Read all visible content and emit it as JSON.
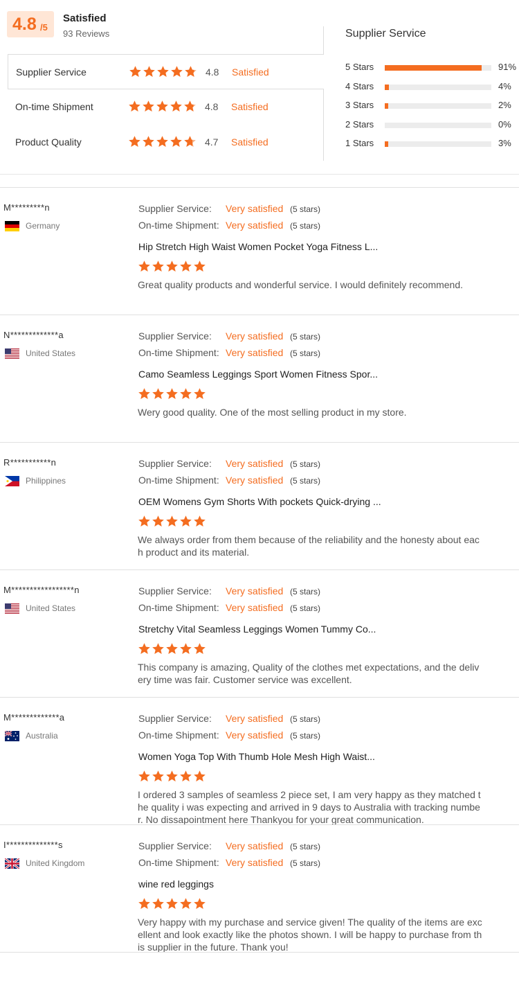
{
  "summary": {
    "score": "4.8",
    "score_suffix": "/5",
    "label": "Satisfied",
    "reviews_count": "93 Reviews"
  },
  "ratings": [
    {
      "label": "Supplier Service",
      "value": "4.8",
      "status": "Satisfied",
      "stars": 4.8
    },
    {
      "label": "On-time Shipment",
      "value": "4.8",
      "status": "Satisfied",
      "stars": 4.8
    },
    {
      "label": "Product Quality",
      "value": "4.7",
      "status": "Satisfied",
      "stars": 4.7
    }
  ],
  "distribution": {
    "title": "Supplier Service",
    "rows": [
      {
        "label": "5  Stars",
        "percent": "91%",
        "fraction": 0.91
      },
      {
        "label": "4  Stars",
        "percent": "4%",
        "fraction": 0.04
      },
      {
        "label": "3  Stars",
        "percent": "2%",
        "fraction": 0.02
      },
      {
        "label": "2  Stars",
        "percent": "0%",
        "fraction": 0.0
      },
      {
        "label": "1  Stars",
        "percent": "3%",
        "fraction": 0.03
      }
    ]
  },
  "colors": {
    "accent": "#f46d20",
    "score_bg": "#ffe6d6",
    "bar_bg": "#ececec"
  },
  "review_labels": {
    "supplier_service": "Supplier Service:",
    "ontime_shipment": "On-time Shipment:"
  },
  "reviews": [
    {
      "name": "M*********n",
      "country": "Germany",
      "flag": "germany-flag-icon",
      "supplier_value": "Very satisfied",
      "supplier_stars": "(5 stars)",
      "shipment_value": "Very satisfied",
      "shipment_stars": "(5 stars)",
      "product": "Hip Stretch High Waist Women Pocket Yoga Fitness L...",
      "rating": 5,
      "text": "Great quality products and wonderful service. I would definitely recommend."
    },
    {
      "name": "N*************a",
      "country": "United States",
      "flag": "usa-flag-icon",
      "supplier_value": "Very satisfied",
      "supplier_stars": "(5 stars)",
      "shipment_value": "Very satisfied",
      "shipment_stars": "(5 stars)",
      "product": "Camo Seamless Leggings Sport Women Fitness Spor...",
      "rating": 5,
      "text": "Wery good quality. One of the most selling product in my store."
    },
    {
      "name": "R***********n",
      "country": "Philippines",
      "flag": "philippines-flag-icon",
      "supplier_value": "Very satisfied",
      "supplier_stars": "(5 stars)",
      "shipment_value": "Very satisfied",
      "shipment_stars": "(5 stars)",
      "product": "OEM Womens Gym Shorts With pockets Quick-drying ...",
      "rating": 5,
      "text": "We always order from them because of the reliability and the honesty about each product and its material."
    },
    {
      "name": "M*****************n",
      "country": "United States",
      "flag": "usa-flag-icon",
      "supplier_value": "Very satisfied",
      "supplier_stars": "(5 stars)",
      "shipment_value": "Very satisfied",
      "shipment_stars": "(5 stars)",
      "product": "Stretchy Vital Seamless Leggings Women Tummy Co...",
      "rating": 5,
      "text": "This company is amazing, Quality of the clothes met expectations, and the delivery time was fair. Customer service was excellent."
    },
    {
      "name": "M*************a",
      "country": "Australia",
      "flag": "australia-flag-icon",
      "supplier_value": "Very satisfied",
      "supplier_stars": "(5 stars)",
      "shipment_value": "Very satisfied",
      "shipment_stars": "(5 stars)",
      "product": "Women Yoga Top With Thumb Hole Mesh High Waist...",
      "rating": 5,
      "text": "I ordered 3 samples of seamless 2 piece set, I am very happy as they matched the quality i was expecting and arrived in 9 days to Australia with tracking number. No dissapointment here Thankyou for your great communication."
    },
    {
      "name": "I**************s",
      "country": "United Kingdom",
      "flag": "uk-flag-icon",
      "supplier_value": "Very satisfied",
      "supplier_stars": "(5 stars)",
      "shipment_value": "Very satisfied",
      "shipment_stars": "(5 stars)",
      "product": "wine red leggings",
      "rating": 5,
      "text": "Very happy with my purchase and service given! The quality of the items are excellent and look exactly like the photos shown. I will be happy to purchase from this supplier in the future. Thank you!"
    }
  ]
}
